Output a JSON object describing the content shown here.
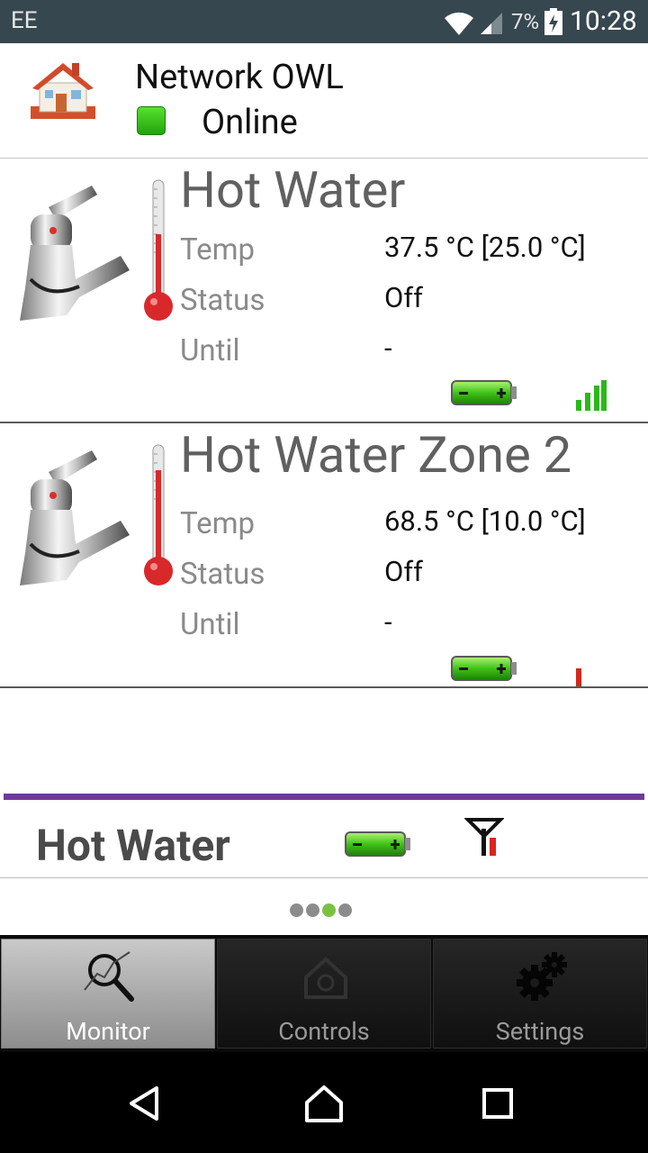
{
  "status_bar": {
    "carrier": "EE",
    "battery_percent": "7%",
    "time": "10:28"
  },
  "header": {
    "name": "Network OWL",
    "status": "Online",
    "status_color": "#2fbf12",
    "icon": "house-icon"
  },
  "zones": [
    {
      "title": "Hot Water",
      "temp_label": "Temp",
      "temp_value": "37.5 °C [25.0 °C]",
      "status_label": "Status",
      "status_value": "Off",
      "until_label": "Until",
      "until_value": "-",
      "signal": "strong"
    },
    {
      "title": "Hot Water Zone 2",
      "temp_label": "Temp",
      "temp_value": "68.5 °C [10.0 °C]",
      "status_label": "Status",
      "status_value": "Off",
      "until_label": "Until",
      "until_value": "-",
      "signal": "weak"
    }
  ],
  "summary": {
    "title": "Hot Water",
    "accent_color": "#6e3a96"
  },
  "pager": {
    "count": 4,
    "active_index": 2,
    "active_color": "#7ac142"
  },
  "tabs": [
    {
      "label": "Monitor",
      "icon": "magnifier-graph-icon",
      "active": true
    },
    {
      "label": "Controls",
      "icon": "house-control-icon",
      "active": false
    },
    {
      "label": "Settings",
      "icon": "gears-icon",
      "active": false
    }
  ]
}
